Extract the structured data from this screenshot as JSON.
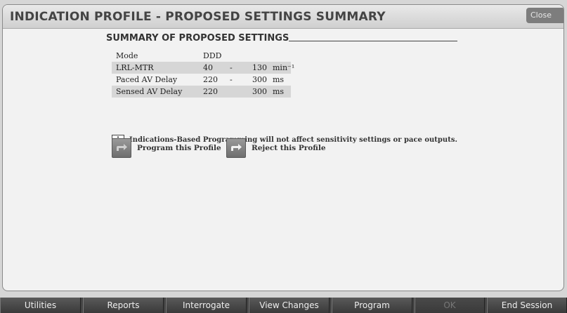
{
  "window": {
    "title": "INDICATION PROFILE - PROPOSED SETTINGS SUMMARY",
    "close_label": "Close"
  },
  "summary": {
    "heading": "SUMMARY OF PROPOSED SETTINGS",
    "rows": [
      {
        "label": "Mode",
        "v1": "DDD",
        "dash": "",
        "v2": "",
        "unit": ""
      },
      {
        "label": "LRL-MTR",
        "v1": "40",
        "dash": "-",
        "v2": "130",
        "unit": "min⁻¹"
      },
      {
        "label": "Paced AV Delay",
        "v1": "220",
        "dash": "-",
        "v2": "300",
        "unit": "ms"
      },
      {
        "label": "Sensed AV Delay",
        "v1": "220",
        "dash": "",
        "v2": "300",
        "unit": "ms"
      }
    ]
  },
  "info": {
    "icon_glyph": "i",
    "text": "Indications-Based Programming will not affect sensitivity settings or pace outputs."
  },
  "actions": {
    "program_label": "Program this Profile",
    "reject_label": "Reject this Profile"
  },
  "taskbar": {
    "utilities": "Utilities",
    "reports": "Reports",
    "interrogate": "Interrogate",
    "view_changes": "View Changes",
    "program": "Program",
    "ok": "OK",
    "end_session": "End Session"
  }
}
